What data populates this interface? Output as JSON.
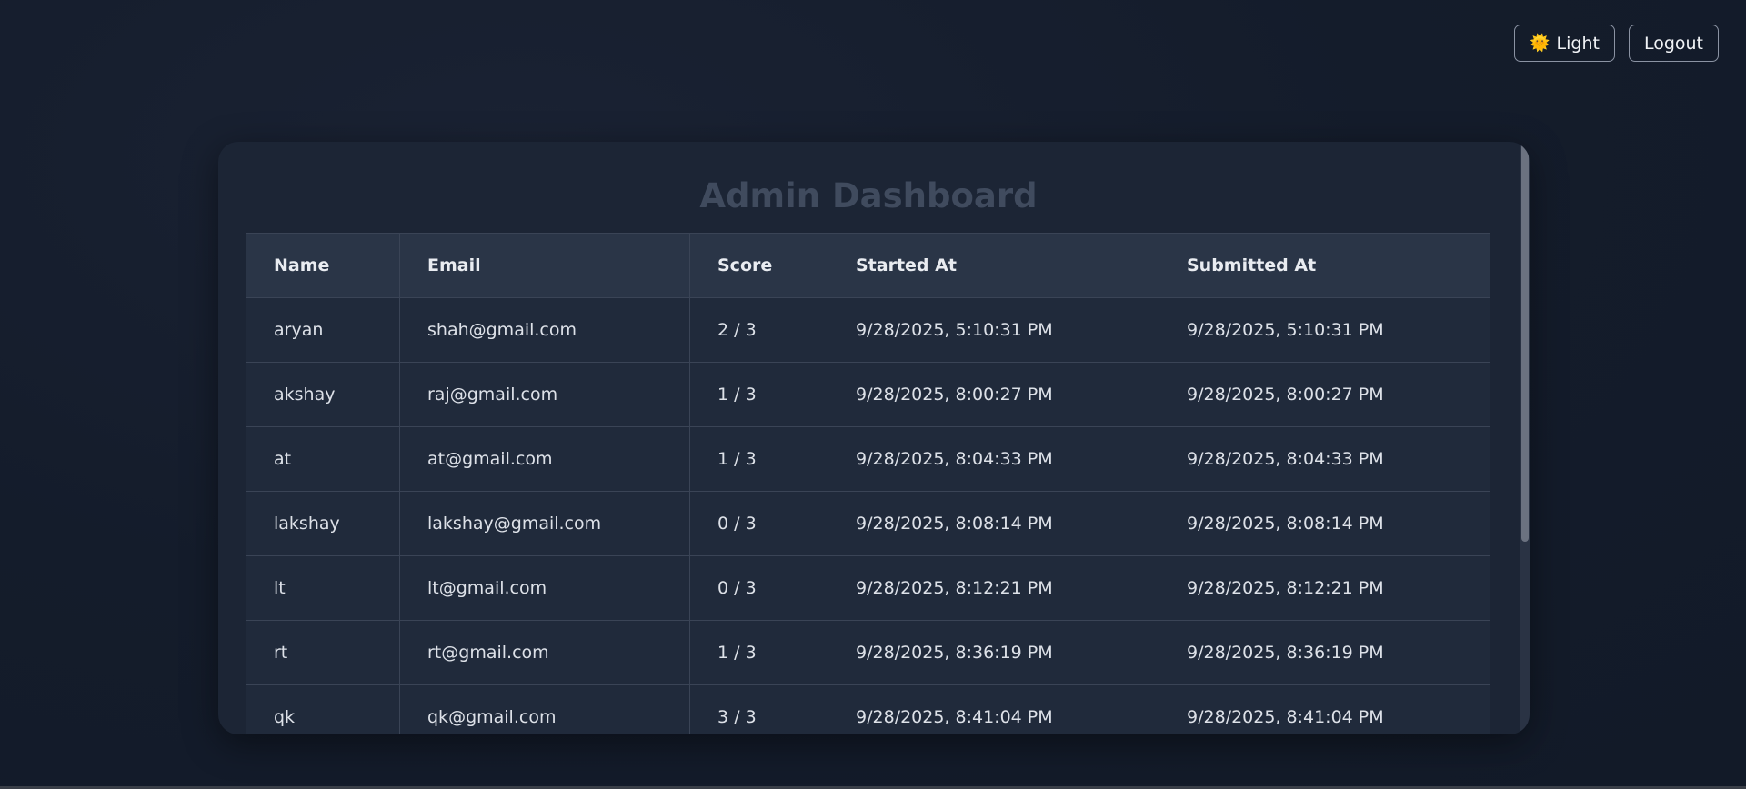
{
  "header": {
    "theme_icon": "sun-emoji-icon",
    "theme_label": "Light",
    "logout_label": "Logout"
  },
  "page": {
    "title": "Admin Dashboard"
  },
  "table": {
    "columns": [
      "Name",
      "Email",
      "Score",
      "Started At",
      "Submitted At"
    ],
    "rows": [
      [
        "aryan",
        "shah@gmail.com",
        "2 / 3",
        "9/28/2025, 5:10:31 PM",
        "9/28/2025, 5:10:31 PM"
      ],
      [
        "akshay",
        "raj@gmail.com",
        "1 / 3",
        "9/28/2025, 8:00:27 PM",
        "9/28/2025, 8:00:27 PM"
      ],
      [
        "at",
        "at@gmail.com",
        "1 / 3",
        "9/28/2025, 8:04:33 PM",
        "9/28/2025, 8:04:33 PM"
      ],
      [
        "lakshay",
        "lakshay@gmail.com",
        "0 / 3",
        "9/28/2025, 8:08:14 PM",
        "9/28/2025, 8:08:14 PM"
      ],
      [
        "lt",
        "lt@gmail.com",
        "0 / 3",
        "9/28/2025, 8:12:21 PM",
        "9/28/2025, 8:12:21 PM"
      ],
      [
        "rt",
        "rt@gmail.com",
        "1 / 3",
        "9/28/2025, 8:36:19 PM",
        "9/28/2025, 8:36:19 PM"
      ],
      [
        "qk",
        "qk@gmail.com",
        "3 / 3",
        "9/28/2025, 8:41:04 PM",
        "9/28/2025, 8:41:04 PM"
      ]
    ]
  },
  "colors": {
    "background": "#131b2a",
    "card": "#1c2535",
    "header_row": "#2a3547",
    "title": "#404b5e"
  }
}
